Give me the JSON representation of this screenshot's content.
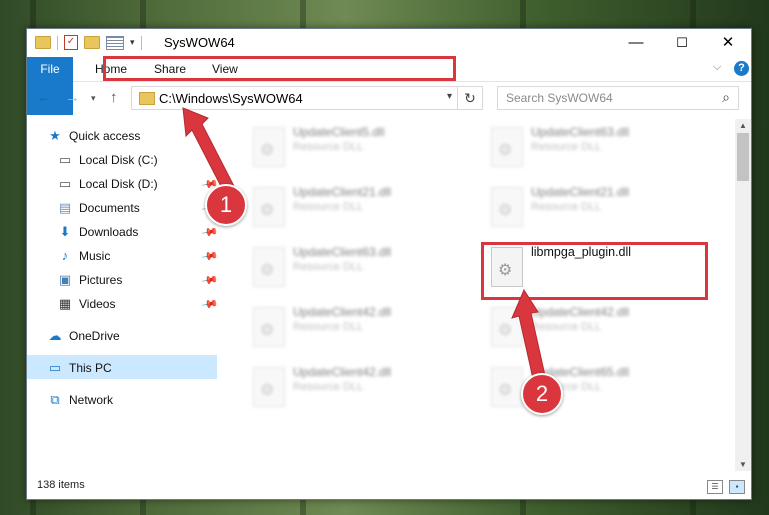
{
  "window": {
    "title": "SysWOW64"
  },
  "controls": {
    "minimize": "—",
    "maximize": "☐",
    "close": "✕"
  },
  "ribbon": {
    "tabs": [
      "File",
      "Home",
      "Share",
      "View"
    ],
    "help": "?"
  },
  "nav": {
    "address": "C:\\Windows\\SysWOW64",
    "search_placeholder": "Search SysWOW64"
  },
  "sidebar": {
    "items": [
      {
        "label": "Quick access",
        "icon": "star-icon"
      },
      {
        "label": "Local Disk (C:)",
        "icon": "drive-icon"
      },
      {
        "label": "Local Disk (D:)",
        "icon": "drive-icon"
      },
      {
        "label": "Documents",
        "icon": "documents-icon"
      },
      {
        "label": "Downloads",
        "icon": "download-icon"
      },
      {
        "label": "Music",
        "icon": "music-icon"
      },
      {
        "label": "Pictures",
        "icon": "pictures-icon"
      },
      {
        "label": "Videos",
        "icon": "videos-icon"
      },
      {
        "label": "OneDrive",
        "icon": "cloud-icon"
      },
      {
        "label": "This PC",
        "icon": "computer-icon"
      },
      {
        "label": "Network",
        "icon": "network-icon"
      }
    ]
  },
  "files": [
    {
      "name": "UpdateClient5.dll",
      "type": "Resource DLL"
    },
    {
      "name": "UpdateClient63.dll",
      "type": "Resource DLL"
    },
    {
      "name": "UpdateClient21.dll",
      "type": "Resource DLL"
    },
    {
      "name": "UpdateClient21.dll",
      "type": "Resource DLL"
    },
    {
      "name": "UpdateClient63.dll",
      "type": "Resource DLL"
    },
    {
      "name": "libmpga_plugin.dll",
      "type": ""
    },
    {
      "name": "UpdateClient42.dll",
      "type": "Resource DLL"
    },
    {
      "name": "UpdateClient42.dll",
      "type": "Resource DLL"
    },
    {
      "name": "UpdateClient42.dll",
      "type": "Resource DLL"
    },
    {
      "name": "UpdateClient65.dll",
      "type": "Resource DLL"
    }
  ],
  "status": {
    "count": "138 items"
  },
  "markers": {
    "one": "1",
    "two": "2"
  },
  "colors": {
    "accent": "#1979ca",
    "highlight": "#d9363e",
    "selected": "#cce8ff"
  }
}
